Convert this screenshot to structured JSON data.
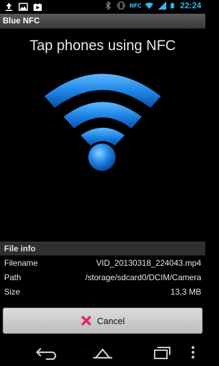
{
  "status_bar": {
    "left_icons": [
      "upload-icon",
      "image-icon",
      "play-store-icon"
    ],
    "right_icons": [
      "bluetooth-icon",
      "vibrate-icon",
      "nfc-icon",
      "wifi-icon",
      "signal-icon",
      "battery-icon"
    ],
    "nfc_label": "NFC",
    "time": "22:24"
  },
  "app": {
    "title": "Blue NFC"
  },
  "main": {
    "headline": "Tap phones using NFC",
    "accent_color": "#1e88e5"
  },
  "file_info": {
    "header": "File info",
    "rows": [
      {
        "label": "Filename",
        "value": "VID_20130318_224043.mp4"
      },
      {
        "label": "Path",
        "value": "/storage/sdcard0/DCIM/Camera"
      },
      {
        "label": "Size",
        "value": "13,3 MB"
      }
    ]
  },
  "actions": {
    "cancel_label": "Cancel"
  },
  "nav": {
    "buttons": [
      "back-icon",
      "home-icon",
      "recent-apps-icon",
      "menu-icon"
    ]
  }
}
